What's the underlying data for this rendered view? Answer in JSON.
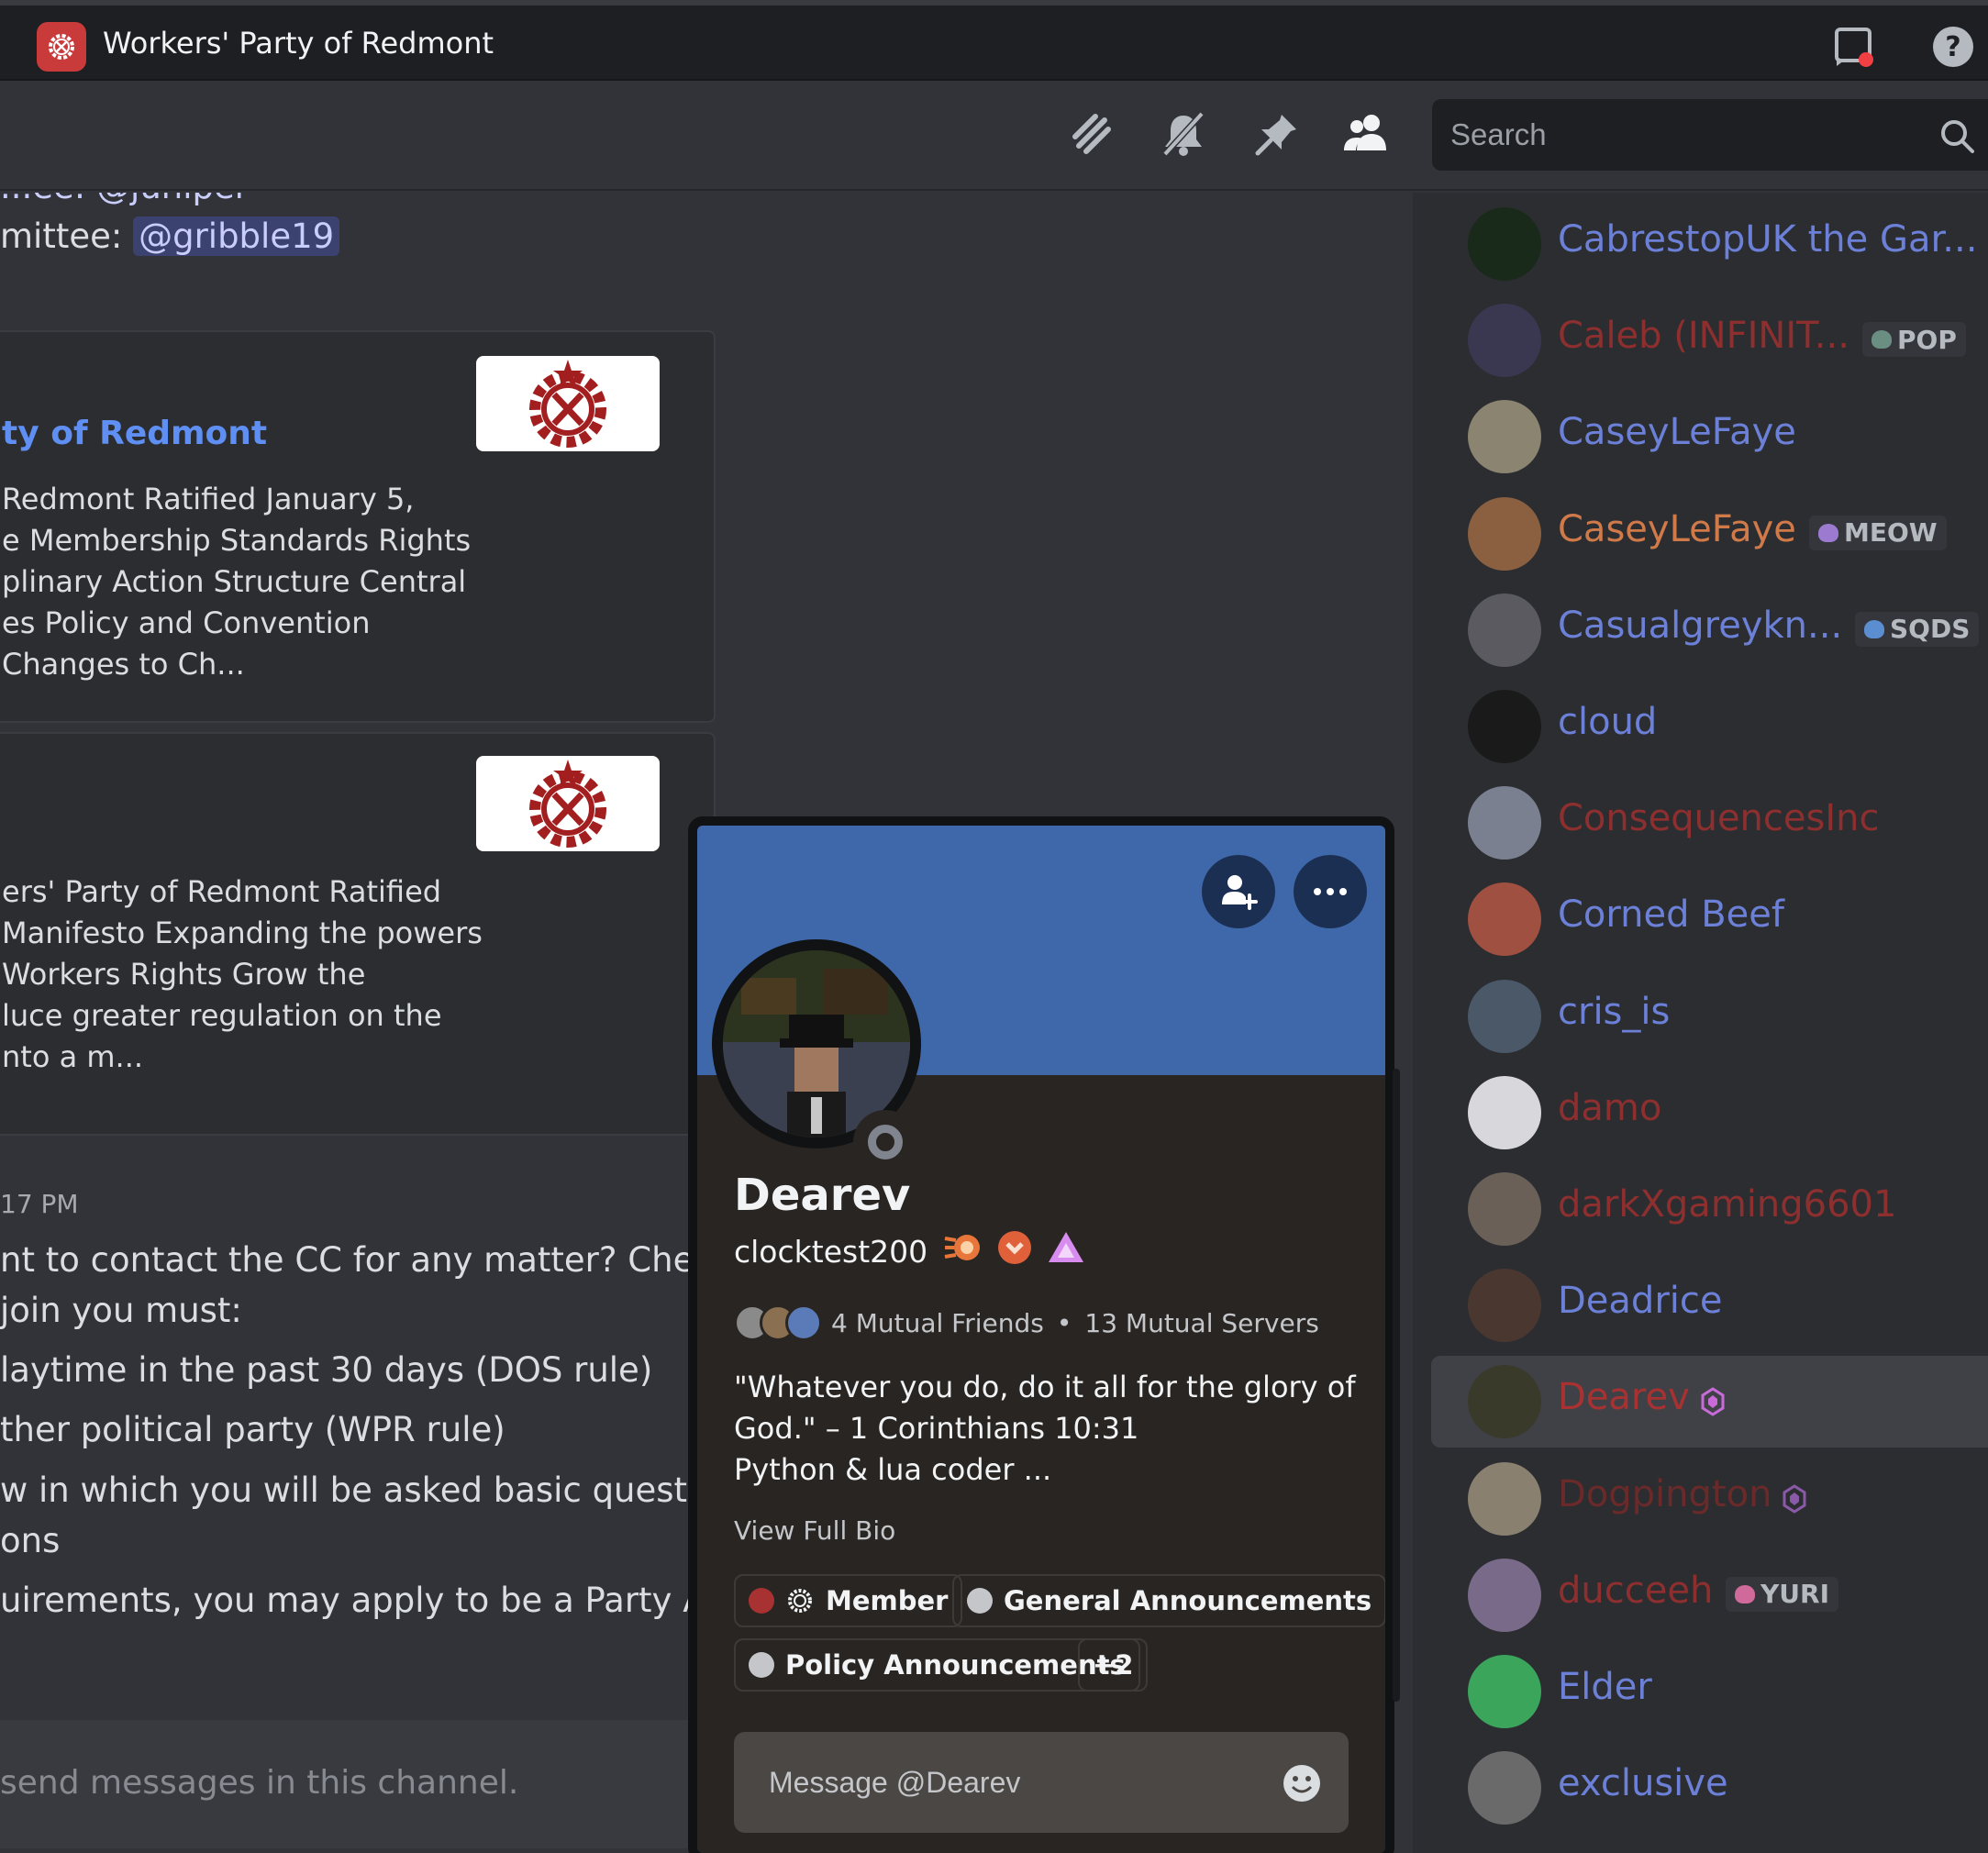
{
  "titlebar": {
    "server_name": "Workers' Party of Redmont",
    "icons": [
      "inbox-icon",
      "help-icon"
    ]
  },
  "header": {
    "icons": [
      "threads-icon",
      "mute-icon",
      "pin-icon",
      "members-icon"
    ],
    "search_placeholder": "Search"
  },
  "chat": {
    "top_partial": "...ee: @juniper",
    "committee_line_prefix": "mittee: ",
    "committee_mention": "@gribble19",
    "embeds": [
      {
        "title": "ty of Redmont",
        "description": [
          "Redmont Ratified January 5,",
          "e Membership Standards Rights",
          "plinary Action Structure Central",
          "es Policy and Convention",
          "Changes to Ch..."
        ]
      },
      {
        "title": "",
        "description": [
          "ers' Party of Redmont Ratified",
          "Manifesto Expanding the powers",
          " Workers Rights Grow the",
          "luce greater regulation on the",
          "nto a m..."
        ]
      }
    ],
    "timestamp": "17 PM",
    "message_lines": [
      "nt to contact the CC for any matter? Check o",
      " join you must:",
      "laytime in the past 30 days (DOS rule)",
      "ther political party (WPR rule)",
      "w in which you will be asked basic questions a",
      "ons",
      "uirements, you may apply to be a Party Asso"
    ],
    "composer_text": "send messages in this channel."
  },
  "members": [
    {
      "name": "CabrestopUK the Gar...",
      "color": "#6b80d6",
      "avatar": "#1a2a1a",
      "tag": ""
    },
    {
      "name": "Caleb (INFINIT...",
      "color": "#8e2f2f",
      "avatar": "#3a3850",
      "tag": "POP",
      "tag_icon": "#6a8e82"
    },
    {
      "name": "CaseyLeFaye",
      "color": "#6b80d6",
      "avatar": "#8a8470",
      "tag": ""
    },
    {
      "name": "CaseyLeFaye",
      "color": "#d07a4a",
      "avatar": "#8a6040",
      "tag": "MEOW",
      "tag_icon": "#9b7ad0"
    },
    {
      "name": "Casualgreykn...",
      "color": "#6b80d6",
      "avatar": "#5a5a60",
      "tag": "SQDS",
      "tag_icon": "#5b8ed0"
    },
    {
      "name": "cloud",
      "color": "#6b80d6",
      "avatar": "#1a1a1a",
      "tag": ""
    },
    {
      "name": "ConsequencesInc",
      "color": "#8e2f2f",
      "avatar": "#7a8090",
      "tag": ""
    },
    {
      "name": "Corned Beef",
      "color": "#6b80d6",
      "avatar": "#a05040",
      "tag": ""
    },
    {
      "name": "cris_is",
      "color": "#6b80d6",
      "avatar": "#4a5868",
      "tag": ""
    },
    {
      "name": "damo",
      "color": "#8e2f2f",
      "avatar": "#d8d8dc",
      "tag": ""
    },
    {
      "name": "darkXgaming6601",
      "color": "#8e2f2f",
      "avatar": "#6a6058",
      "tag": ""
    },
    {
      "name": "Deadrice",
      "color": "#6b80d6",
      "avatar": "#4a3830",
      "tag": ""
    },
    {
      "name": "Dearev",
      "color": "#a83232",
      "avatar": "#3a3a2a",
      "tag": "",
      "selected": true,
      "gem": "#c86bd8"
    },
    {
      "name": "Dogpington",
      "color": "#6a2a2a",
      "avatar": "#8a8070",
      "tag": "",
      "gem": "#8a5aa8"
    },
    {
      "name": "ducceeh",
      "color": "#8e2f2f",
      "avatar": "#7a6a8a",
      "tag": "YURI",
      "tag_icon": "#d06a9a"
    },
    {
      "name": "Elder",
      "color": "#6b80d6",
      "avatar": "#3ba55c",
      "tag": ""
    },
    {
      "name": "exclusive",
      "color": "#6b80d6",
      "avatar": "#6a6a6a",
      "tag": ""
    }
  ],
  "profile": {
    "display_name": "Dearev",
    "username": "clocktest200",
    "mutual_friends": "4 Mutual Friends",
    "separator": "•",
    "mutual_servers": "13 Mutual Servers",
    "bio_lines": [
      "\"Whatever you do, do it all for the glory of",
      "God.\" – 1 Corinthians 10:31",
      "Python & lua coder ..."
    ],
    "view_full_bio": "View Full Bio",
    "roles": [
      {
        "label": "Member",
        "color": "#a83232"
      },
      {
        "label": "General Announcements",
        "color": "#c4c6ca"
      },
      {
        "label": "Policy Announcements",
        "color": "#c4c6ca"
      }
    ],
    "more_roles": "+2",
    "message_placeholder": "Message @Dearev",
    "banner_color": "#3f68ab"
  }
}
